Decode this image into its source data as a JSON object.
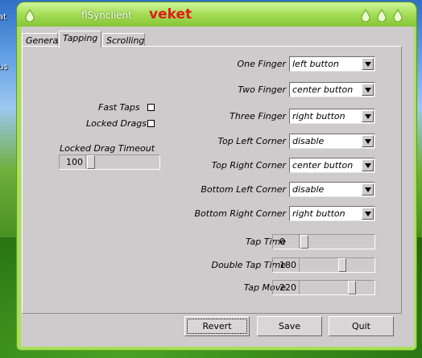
{
  "desktop": {
    "labels": [
      "at",
      "us"
    ]
  },
  "window": {
    "title": "flSynclient",
    "brand": "veket"
  },
  "tabs": [
    {
      "label": "General"
    },
    {
      "label": "Tapping"
    },
    {
      "label": "Scrolling"
    }
  ],
  "active_tab": "Tapping",
  "left": {
    "fast_taps": "Fast Taps",
    "locked_drags": "Locked Drags",
    "timeout_label": "Locked Drag Timeout",
    "timeout_value": "100",
    "timeout_fraction": 0.0
  },
  "fingers": [
    {
      "label": "One Finger",
      "value": "left button"
    },
    {
      "label": "Two Finger",
      "value": "center button"
    },
    {
      "label": "Three Finger",
      "value": "right button"
    }
  ],
  "corners": [
    {
      "label": "Top Left Corner",
      "value": "disable"
    },
    {
      "label": "Top Right Corner",
      "value": "center button"
    },
    {
      "label": "Bottom Left Corner",
      "value": "disable"
    },
    {
      "label": "Bottom Right Corner",
      "value": "right button"
    }
  ],
  "sliders": [
    {
      "label": "Tap Time",
      "value": "0",
      "fraction": 0.0
    },
    {
      "label": "Double Tap Time",
      "value": "180",
      "fraction": 0.57
    },
    {
      "label": "Tap Move",
      "value": "220",
      "fraction": 0.72
    }
  ],
  "buttons": {
    "revert": "Revert",
    "save": "Save",
    "quit": "Quit"
  }
}
